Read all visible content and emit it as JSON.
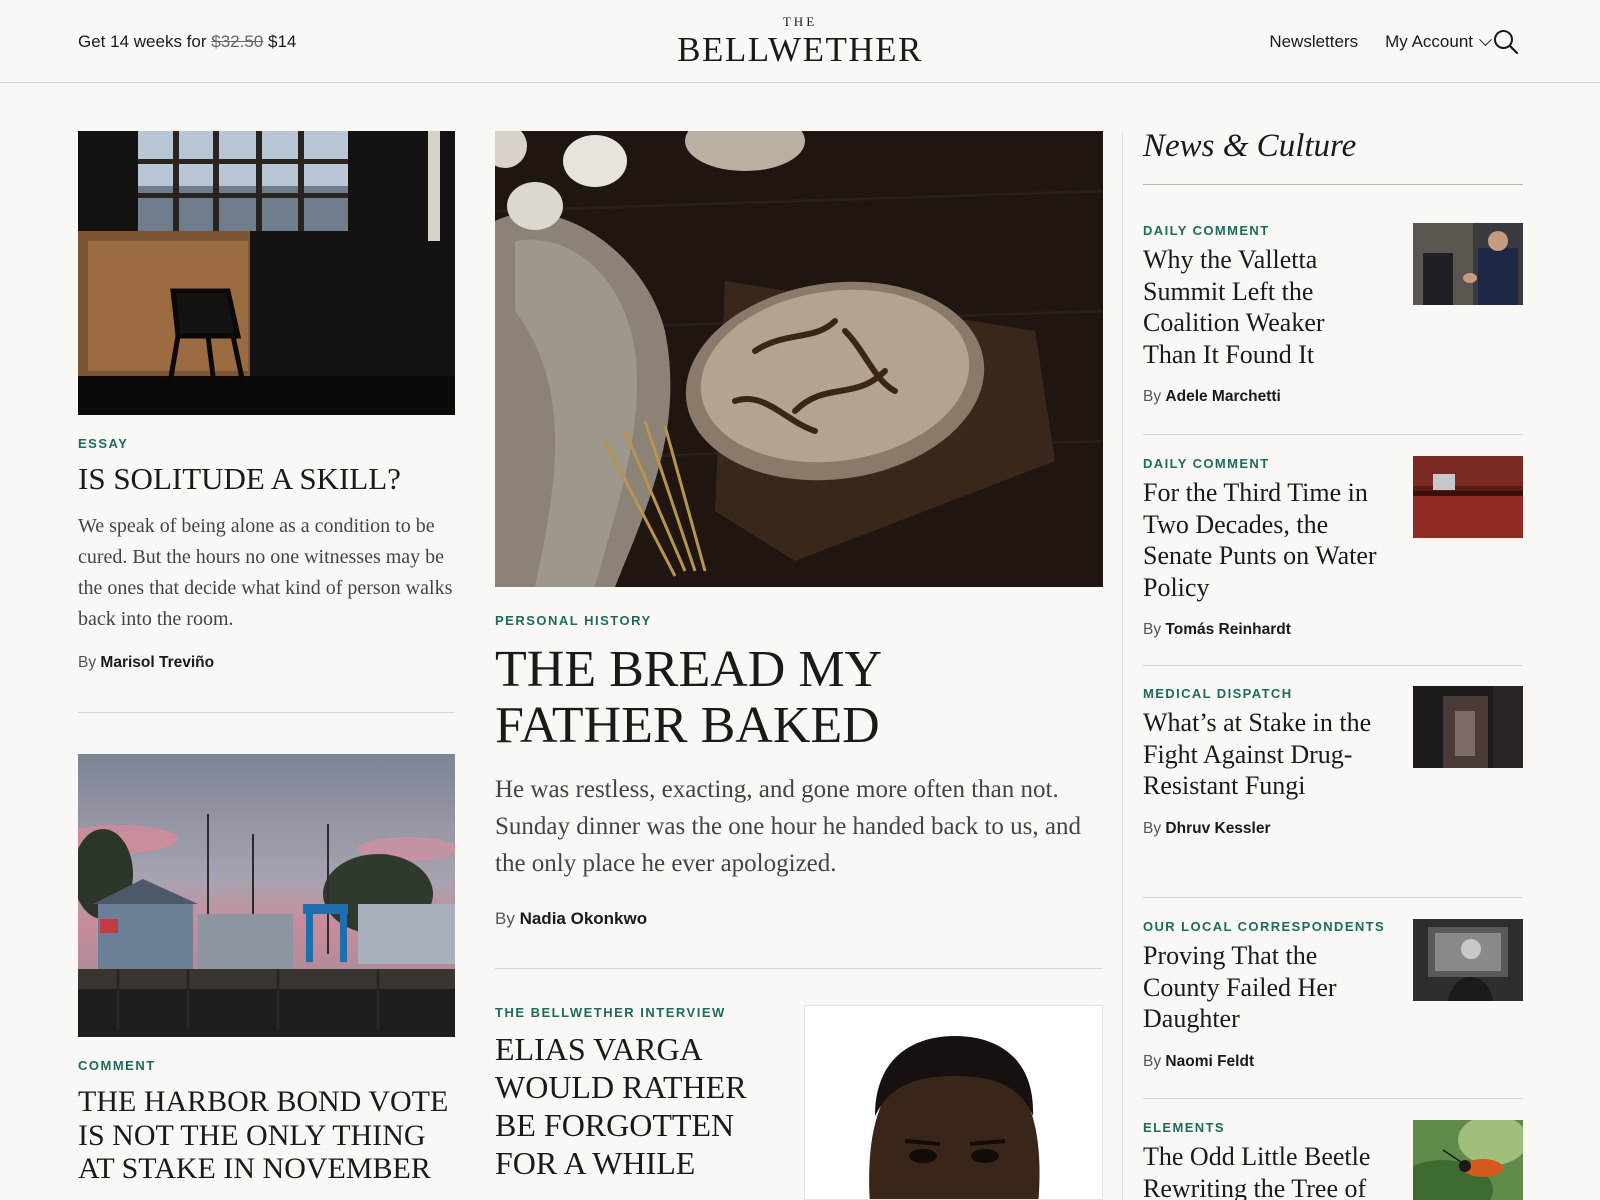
{
  "header": {
    "promo_prefix": "Get 14 weeks for",
    "promo_old_price": "$32.50",
    "promo_new_price": "$14",
    "logo_the": "THE",
    "logo_name": "BELLWETHER",
    "nav_newsletters": "Newsletters",
    "nav_account": "My Account"
  },
  "left_top": {
    "kicker": "ESSAY",
    "headline": "IS SOLITUDE A SKILL?",
    "dek": "We speak of being alone as a condition to be cured. But the hours no one witnesses may be the ones that decide what kind of person walks back into the room.",
    "by": "By",
    "author": "Marisol Treviño"
  },
  "left_bottom": {
    "kicker": "COMMENT",
    "headline": "THE HARBOR BOND VOTE IS NOT THE ONLY THING AT STAKE IN NOVEMBER"
  },
  "feature": {
    "kicker": "PERSONAL HISTORY",
    "headline_line1": "THE BREAD MY",
    "headline_line2": "FATHER BAKED",
    "dek": "He was restless, exacting, and gone more often than not. Sunday dinner was the one hour he handed back to us, and the only place he ever apologized.",
    "by": "By",
    "author": "Nadia Okonkwo"
  },
  "interview": {
    "kicker": "THE BELLWETHER INTERVIEW",
    "headline": "ELIAS VARGA WOULD RATHER BE FORGOTTEN FOR A WHILE"
  },
  "sidebar": {
    "title": "News & Culture",
    "items": [
      {
        "kicker": "DAILY COMMENT",
        "headline": "Why the Valletta Summit Left the Coalition Weaker Than It Found It",
        "by": "By",
        "author": "Adele Marchetti"
      },
      {
        "kicker": "DAILY COMMENT",
        "headline": "For the Third Time in Two Decades, the Senate Punts on Water Policy",
        "by": "By",
        "author": "Tomás Reinhardt"
      },
      {
        "kicker": "MEDICAL DISPATCH",
        "headline": "What’s at Stake in the Fight Against Drug-Resistant Fungi",
        "by": "By",
        "author": "Dhruv Kessler"
      },
      {
        "kicker": "OUR LOCAL CORRESPONDENTS",
        "headline": "Proving That the County Failed Her Daughter",
        "by": "By",
        "author": "Naomi Feldt"
      },
      {
        "kicker": "ELEMENTS",
        "headline": "The Odd Little Beetle Rewriting the Tree of Life",
        "by": "",
        "author": ""
      }
    ]
  },
  "icons": {
    "search": "search-icon",
    "chevron": "chevron-down-icon"
  },
  "colors": {
    "background": "#f9f8f4",
    "kicker": "#1d6b5f",
    "text": "#1a1a1a"
  }
}
